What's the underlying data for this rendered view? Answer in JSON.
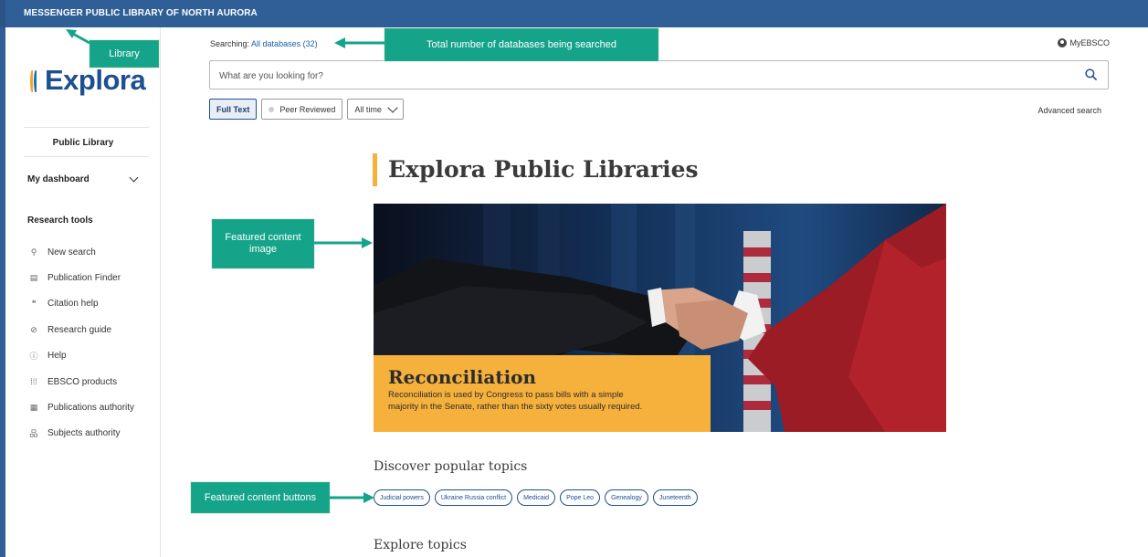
{
  "topbar": {
    "library_name": "MESSENGER PUBLIC LIBRARY OF NORTH AURORA"
  },
  "logo": {
    "text": "Explora"
  },
  "sidebar": {
    "library_type": "Public Library",
    "dashboard_label": "My dashboard",
    "research_tools_title": "Research tools",
    "tools": [
      {
        "label": "New search",
        "icon": "search-icon",
        "glyph": "⚲"
      },
      {
        "label": "Publication Finder",
        "icon": "document-icon",
        "glyph": "▤"
      },
      {
        "label": "Citation help",
        "icon": "quote-icon",
        "glyph": "❝"
      },
      {
        "label": "Research guide",
        "icon": "compass-icon",
        "glyph": "⊘"
      },
      {
        "label": "Help",
        "icon": "help-icon",
        "glyph": "ⓘ"
      },
      {
        "label": "EBSCO products",
        "icon": "grid-icon",
        "glyph": "⁞⁞⁞"
      },
      {
        "label": "Publications authority",
        "icon": "book-icon",
        "glyph": "▦"
      },
      {
        "label": "Subjects authority",
        "icon": "hierarchy-icon",
        "glyph": "品"
      }
    ]
  },
  "header": {
    "searching_label": "Searching:",
    "databases_link": "All databases (32)",
    "myebsco": "MyEBSCO",
    "search_placeholder": "What are you looking for?",
    "advanced_search": "Advanced search"
  },
  "filters": {
    "full_text": "Full Text",
    "peer_reviewed": "Peer Reviewed",
    "date_range": "All time"
  },
  "main": {
    "page_title": "Explora Public Libraries",
    "featured": {
      "title": "Reconciliation",
      "text_line1": "Reconciliation is used by Congress to pass bills with a simple",
      "text_line2": "majority in the Senate, rather than the sixty votes usually required."
    },
    "discover_title": "Discover popular topics",
    "topics": [
      "Judicial powers",
      "Ukraine Russia conflict",
      "Medicaid",
      "Pope Leo",
      "Genealogy",
      "Juneteenth"
    ],
    "explore_title": "Explore topics"
  },
  "annotations": {
    "library": "Library",
    "databases": "Total number of databases being searched",
    "featured_image_line1": "Featured content",
    "featured_image_line2": "image",
    "featured_buttons": "Featured content buttons"
  },
  "colors": {
    "topbar": "#2f5f96",
    "brand_blue": "#1d4f91",
    "accent_gold": "#f6b13d",
    "callout_green": "#15a48a"
  }
}
